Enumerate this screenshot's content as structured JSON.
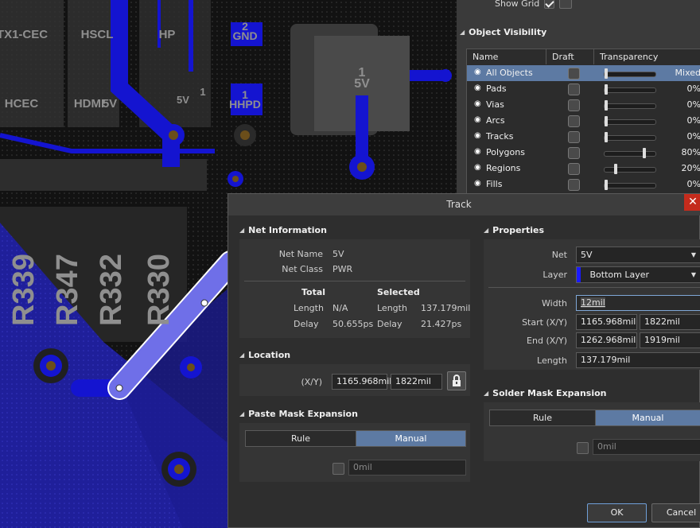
{
  "pcb": {
    "pad_labels": [
      {
        "text": "TX1-CEC"
      },
      {
        "text": "HSCL"
      },
      {
        "text": "HP"
      },
      {
        "text": "2"
      },
      {
        "text": "GND"
      },
      {
        "text": "1"
      },
      {
        "text": "5V"
      },
      {
        "text": "HCEC"
      },
      {
        "text": "HDMI"
      },
      {
        "text": "5V"
      },
      {
        "text": "1"
      },
      {
        "text": "HHPD"
      },
      {
        "text": "1"
      },
      {
        "text": "5V"
      }
    ],
    "designators": [
      "R339",
      "R347",
      "R332",
      "R330"
    ]
  },
  "object_panel": {
    "show_grid_label": "Show Grid",
    "section_title": "Object Visibility",
    "columns": [
      "Name",
      "Draft",
      "Transparency"
    ],
    "rows": [
      {
        "name": "All Objects",
        "draft": false,
        "transparency": "Mixed",
        "level": 0.0,
        "selected": true
      },
      {
        "name": "Pads",
        "draft": false,
        "transparency": "0%",
        "level": 0.0,
        "selected": false
      },
      {
        "name": "Vias",
        "draft": false,
        "transparency": "0%",
        "level": 0.0,
        "selected": false
      },
      {
        "name": "Arcs",
        "draft": false,
        "transparency": "0%",
        "level": 0.0,
        "selected": false
      },
      {
        "name": "Tracks",
        "draft": false,
        "transparency": "0%",
        "level": 0.0,
        "selected": false
      },
      {
        "name": "Polygons",
        "draft": false,
        "transparency": "80%",
        "level": 0.8,
        "selected": false
      },
      {
        "name": "Regions",
        "draft": false,
        "transparency": "20%",
        "level": 0.2,
        "selected": false
      },
      {
        "name": "Fills",
        "draft": false,
        "transparency": "0%",
        "level": 0.0,
        "selected": false
      }
    ]
  },
  "dialog": {
    "title": "Track",
    "close_icon": "close-icon",
    "net_info": {
      "title": "Net Information",
      "net_name_label": "Net Name",
      "net_name": "5V",
      "net_class_label": "Net Class",
      "net_class": "PWR",
      "total_header": "Total",
      "selected_header": "Selected",
      "length_label": "Length",
      "total_length": "N/A",
      "selected_length": "137.179mil",
      "delay_label": "Delay",
      "total_delay": "50.655ps",
      "selected_delay": "21.427ps"
    },
    "location": {
      "title": "Location",
      "xy_label": "(X/Y)",
      "x": "1165.968mil",
      "y": "1822mil"
    },
    "paste_mask": {
      "title": "Paste Mask Expansion",
      "rule_label": "Rule",
      "manual_label": "Manual",
      "value_placeholder": "0mil"
    },
    "properties": {
      "title": "Properties",
      "net_label": "Net",
      "net_value": "5V",
      "layer_label": "Layer",
      "layer_value": "Bottom Layer",
      "layer_color": "#1a1aff",
      "width_label": "Width",
      "width_value": "12mil",
      "start_label": "Start (X/Y)",
      "start_x": "1165.968mil",
      "start_y": "1822mil",
      "end_label": "End (X/Y)",
      "end_x": "1262.968mil",
      "end_y": "1919mil",
      "length_label": "Length",
      "length_value": "137.179mil"
    },
    "solder_mask": {
      "title": "Solder Mask Expansion",
      "rule_label": "Rule",
      "manual_label": "Manual",
      "value_placeholder": "0mil"
    },
    "buttons": {
      "ok": "OK",
      "cancel": "Cancel"
    }
  }
}
